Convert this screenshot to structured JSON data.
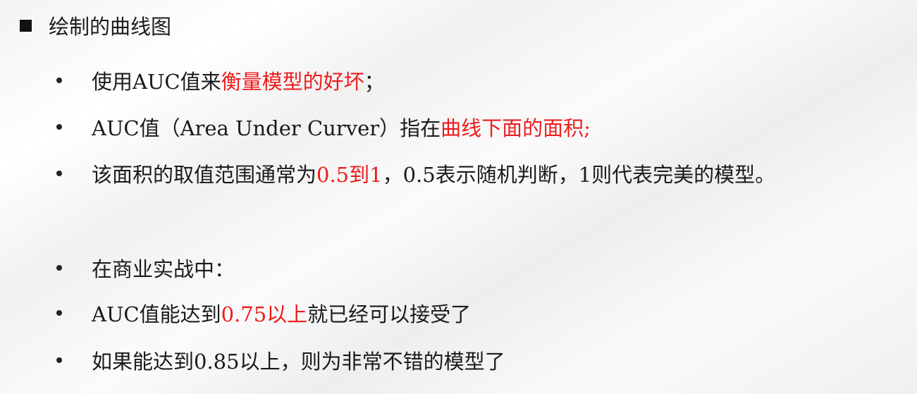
{
  "heading": {
    "text": "绘制的曲线图"
  },
  "bullets": [
    {
      "parts": [
        "使用AUC值来",
        "衡量模型的好坏",
        "；"
      ]
    },
    {
      "parts": [
        "AUC值（Area Under Curver）指在",
        "曲线下面的面积;"
      ]
    },
    {
      "parts": [
        "该面积的取值范围通常为",
        "0.5到1",
        "，0.5表示随机判断，1则代表完美的模型。"
      ]
    },
    {
      "parts": [
        "在商业实战中："
      ]
    },
    {
      "parts": [
        "AUC值能达到",
        "0.75以上",
        "就已经可以接受了"
      ]
    },
    {
      "parts": [
        "如果能达到0.85以上，则为非常不错的模型了"
      ]
    }
  ],
  "colors": {
    "emphasis": "#ee1c1c",
    "text": "#1b1b1b",
    "marker": "#111111"
  }
}
